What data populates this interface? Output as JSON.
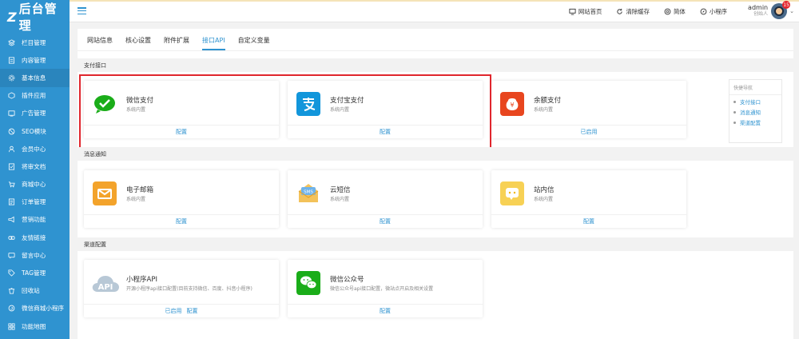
{
  "logo": {
    "mark": "Z",
    "text": "后台管理"
  },
  "sidebar": {
    "items": [
      {
        "label": "栏目管理",
        "icon": "layers-icon"
      },
      {
        "label": "内容管理",
        "icon": "document-icon"
      },
      {
        "label": "基本信息",
        "icon": "gear-icon",
        "active": true
      },
      {
        "label": "插件应用",
        "icon": "plugin-icon"
      },
      {
        "label": "广告管理",
        "icon": "ad-icon"
      },
      {
        "label": "SEO模块",
        "icon": "seo-icon"
      },
      {
        "label": "会员中心",
        "icon": "user-icon"
      },
      {
        "label": "将审文档",
        "icon": "doc-review-icon"
      },
      {
        "label": "商城中心",
        "icon": "cart-icon"
      },
      {
        "label": "订单管理",
        "icon": "order-icon"
      },
      {
        "label": "营销功能",
        "icon": "marketing-icon"
      },
      {
        "label": "友情链接",
        "icon": "link-icon"
      },
      {
        "label": "留言中心",
        "icon": "message-icon"
      },
      {
        "label": "TAG管理",
        "icon": "tag-icon"
      },
      {
        "label": "回收站",
        "icon": "trash-icon"
      },
      {
        "label": "微信商城小程序",
        "icon": "miniprogram-icon"
      },
      {
        "label": "功能地图",
        "icon": "grid-icon"
      }
    ]
  },
  "topbar": {
    "actions": [
      {
        "label": "网站首页",
        "icon": "monitor-icon"
      },
      {
        "label": "清除缓存",
        "icon": "refresh-icon"
      },
      {
        "label": "简体",
        "icon": "globe-icon"
      },
      {
        "label": "小程序",
        "icon": "compass-icon"
      }
    ],
    "user": {
      "name": "admin",
      "role": "创始人",
      "badge": "15"
    }
  },
  "tabs": [
    {
      "label": "网站信息"
    },
    {
      "label": "核心设置"
    },
    {
      "label": "附件扩展"
    },
    {
      "label": "接口API",
      "active": true
    },
    {
      "label": "自定义变量"
    }
  ],
  "sections": {
    "payment": "支付接口",
    "notify": "消息通知",
    "channel": "渠道配置"
  },
  "cards": {
    "wechat_pay": {
      "title": "微信支付",
      "desc": "系统内置",
      "action": "配置"
    },
    "alipay": {
      "title": "支付宝支付",
      "desc": "系统内置",
      "action": "配置"
    },
    "balance": {
      "title": "余额支付",
      "desc": "系统内置",
      "action": "已启用"
    },
    "email": {
      "title": "电子邮箱",
      "desc": "系统内置",
      "action": "配置"
    },
    "sms": {
      "title": "云短信",
      "desc": "系统内置",
      "action": "配置",
      "icon_text": "SMS"
    },
    "station": {
      "title": "站内信",
      "desc": "系统内置",
      "action": "配置"
    },
    "miniapp": {
      "title": "小程序API",
      "desc": "开源小程序api接口配置(目前支持微信、百度、抖音小程序)",
      "status": "已启用",
      "action": "配置",
      "icon_text": "API"
    },
    "mp": {
      "title": "微信公众号",
      "desc": "微信公众号api接口配置，微站点开启及相关设置",
      "action": "配置"
    }
  },
  "quick_nav": {
    "title": "快捷导航",
    "items": [
      {
        "label": "支付接口"
      },
      {
        "label": "消息通知"
      },
      {
        "label": "渠道配置"
      }
    ]
  },
  "colors": {
    "sidebar": "#2f93d0",
    "accent": "#2f93d0",
    "highlight": "#e0262d",
    "wechat_green": "#1aad19",
    "alipay_blue": "#1296db",
    "balance_red": "#e8461f",
    "mail_orange": "#f3a32b",
    "station_yellow": "#f7d155"
  }
}
